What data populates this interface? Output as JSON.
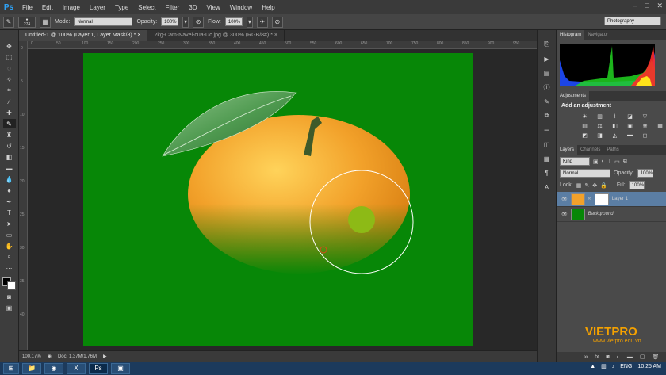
{
  "app": {
    "logo": "Ps",
    "menu": [
      "File",
      "Edit",
      "Image",
      "Layer",
      "Type",
      "Select",
      "Filter",
      "3D",
      "View",
      "Window",
      "Help"
    ],
    "window_controls": [
      "–",
      "□",
      "✕"
    ]
  },
  "options": {
    "brush_size": "274",
    "mode_label": "Mode:",
    "mode_value": "Normal",
    "opacity_label": "Opacity:",
    "opacity_value": "100%",
    "flow_label": "Flow:",
    "flow_value": "100%",
    "workspace": "Photography"
  },
  "tabs": [
    {
      "label": "Untitled-1 @ 100% (Layer 1, Layer Mask/8) *",
      "active": true
    },
    {
      "label": "2kg-Cam-Navel-cua-Uc.jpg @ 300% (RGB/8#) *",
      "active": false
    }
  ],
  "ruler": {
    "h": [
      "0",
      "50",
      "100",
      "150",
      "200",
      "250",
      "300",
      "350",
      "400",
      "450",
      "500",
      "550",
      "600",
      "650",
      "700",
      "750",
      "800",
      "850",
      "900",
      "950"
    ],
    "v": [
      "0",
      "5",
      "10",
      "15",
      "20",
      "25",
      "30",
      "35",
      "40"
    ]
  },
  "status": {
    "zoom": "100.17%",
    "doc": "Doc: 1.37M/1.76M"
  },
  "panels": {
    "histogram_tabs": [
      "Histogram",
      "Navigator"
    ],
    "adjustments_tab": "Adjustments",
    "adjustments_title": "Add an adjustment",
    "layers_tabs": [
      "Layers",
      "Channels",
      "Paths"
    ],
    "kind_value": "Kind",
    "blend_value": "Normal",
    "opacity_label": "Opacity:",
    "opacity_value": "100%",
    "lock_label": "Lock:",
    "fill_label": "Fill:",
    "fill_value": "100%",
    "layers": [
      {
        "name": "Layer 1",
        "selected": true
      },
      {
        "name": "Background",
        "selected": false
      }
    ]
  },
  "taskbar": {
    "lang": "ENG",
    "time": "10:25 AM"
  },
  "watermark": {
    "brand": "VIETPRO",
    "url": "www.vietpro.edu.vn"
  },
  "colors": {
    "canvas_green": "#078707",
    "selected_layer": "#5b7ea4",
    "accent_blue": "#2fa3f7"
  }
}
